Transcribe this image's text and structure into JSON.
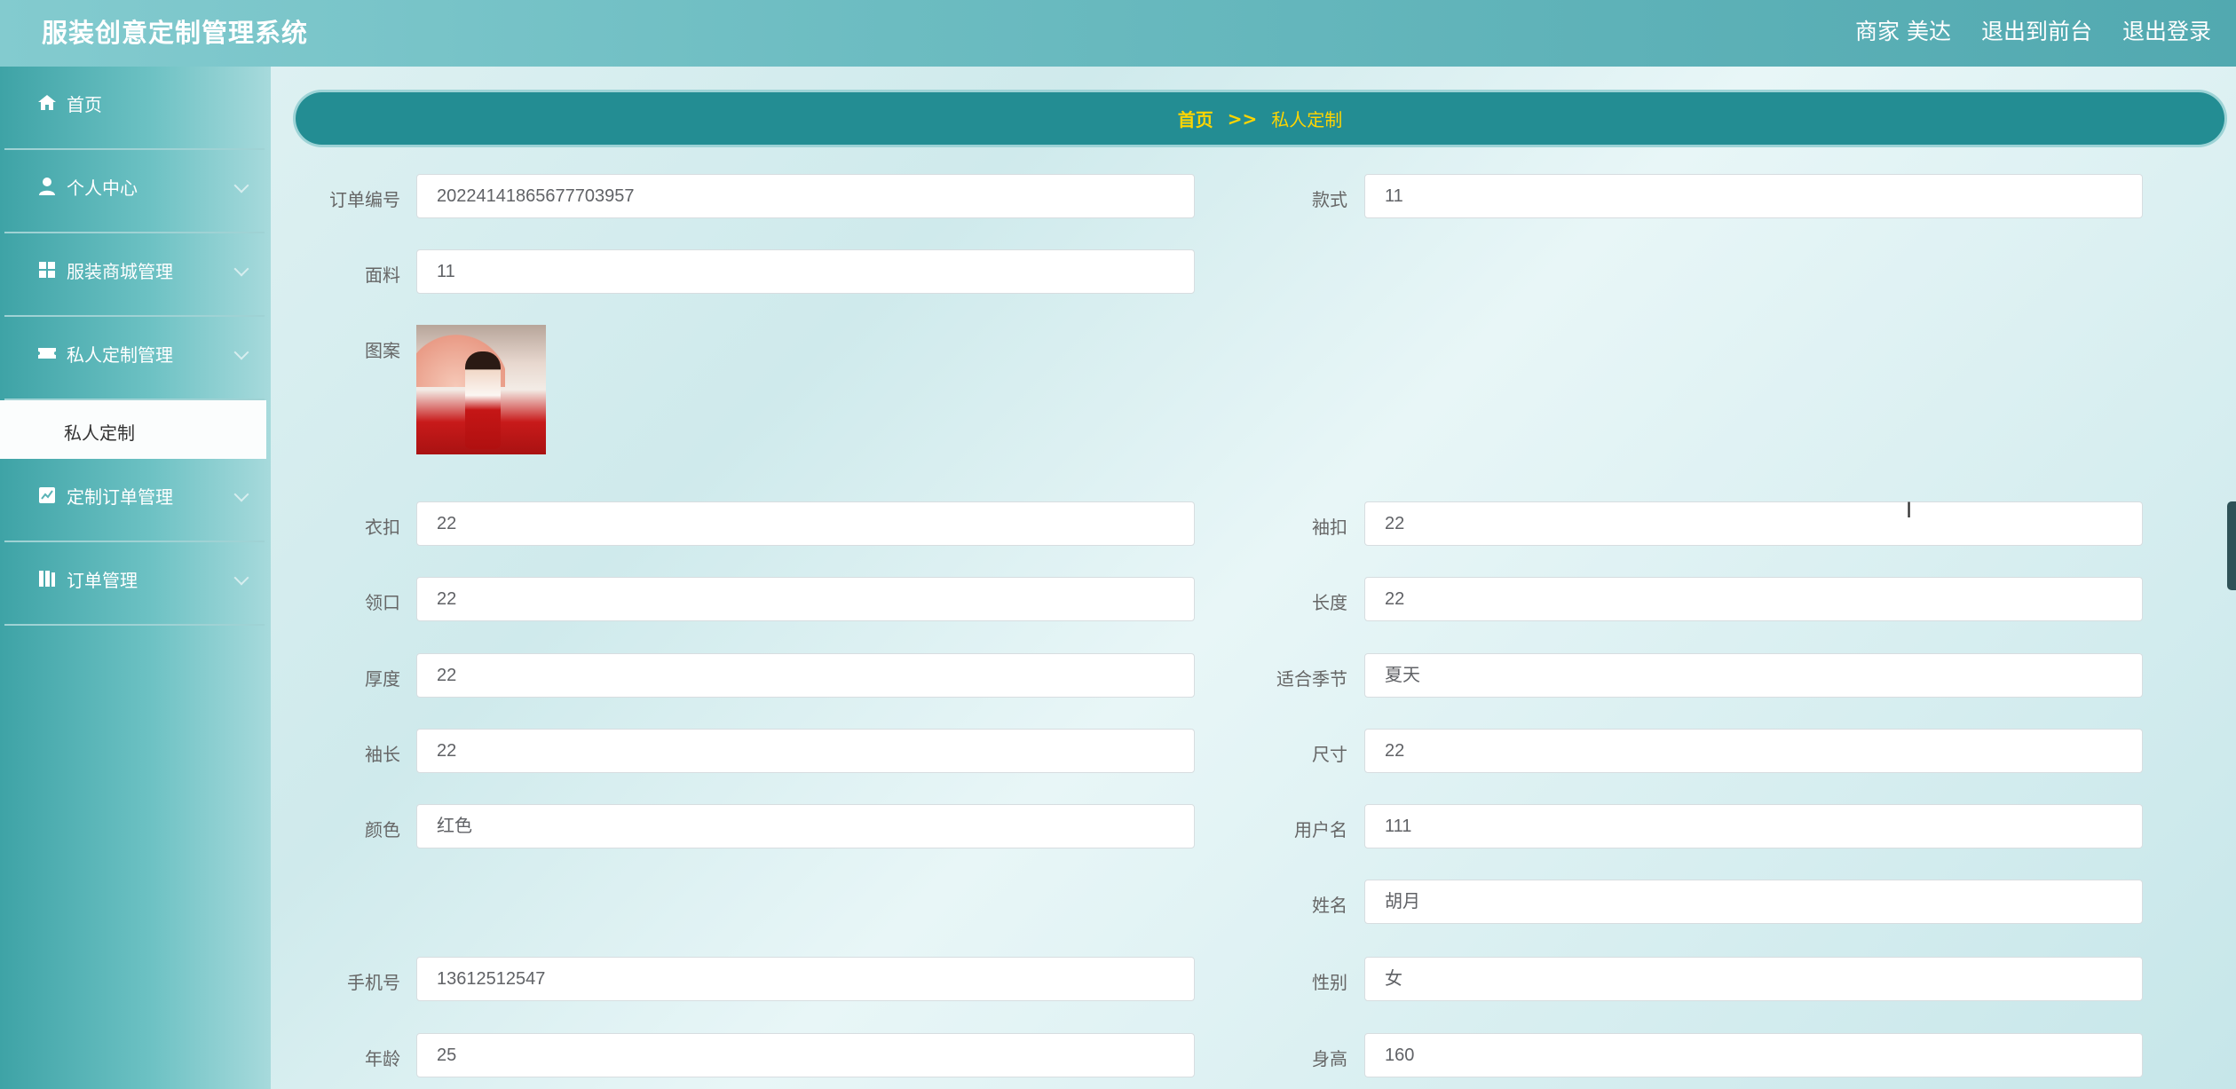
{
  "app": {
    "title": "服装创意定制管理系统"
  },
  "header": {
    "user": "商家 美达",
    "back_to_front": "退出到前台",
    "logout": "退出登录"
  },
  "sidebar": {
    "items": [
      {
        "label": "首页",
        "icon": "home-icon"
      },
      {
        "label": "个人中心",
        "icon": "user-icon"
      },
      {
        "label": "服装商城管理",
        "icon": "grid-icon"
      },
      {
        "label": "私人定制管理",
        "icon": "ticket-icon"
      },
      {
        "label": "私人定制",
        "icon": ""
      },
      {
        "label": "定制订单管理",
        "icon": "chart-icon"
      },
      {
        "label": "订单管理",
        "icon": "book-icon"
      }
    ]
  },
  "breadcrumb": {
    "home": "首页",
    "sep": ">>",
    "current": "私人定制"
  },
  "form": {
    "order_no": {
      "label": "订单编号",
      "value": "20224141865677703957"
    },
    "style": {
      "label": "款式",
      "value": "11"
    },
    "fabric": {
      "label": "面料",
      "value": "11"
    },
    "pattern": {
      "label": "图案",
      "image": "girl-with-red-umbrella"
    },
    "button": {
      "label": "衣扣",
      "value": "22"
    },
    "cufflink": {
      "label": "袖扣",
      "value": "22"
    },
    "collar": {
      "label": "领口",
      "value": "22"
    },
    "length": {
      "label": "长度",
      "value": "22"
    },
    "thickness": {
      "label": "厚度",
      "value": "22"
    },
    "season": {
      "label": "适合季节",
      "value": "夏天"
    },
    "sleeve": {
      "label": "袖长",
      "value": "22"
    },
    "size": {
      "label": "尺寸",
      "value": "22"
    },
    "color": {
      "label": "颜色",
      "value": "红色"
    },
    "username": {
      "label": "用户名",
      "value": "111"
    },
    "name": {
      "label": "姓名",
      "value": "胡月"
    },
    "phone": {
      "label": "手机号",
      "value": "13612512547"
    },
    "gender": {
      "label": "性别",
      "value": "女"
    },
    "age": {
      "label": "年龄",
      "value": "25"
    },
    "height": {
      "label": "身高",
      "value": "160"
    }
  }
}
